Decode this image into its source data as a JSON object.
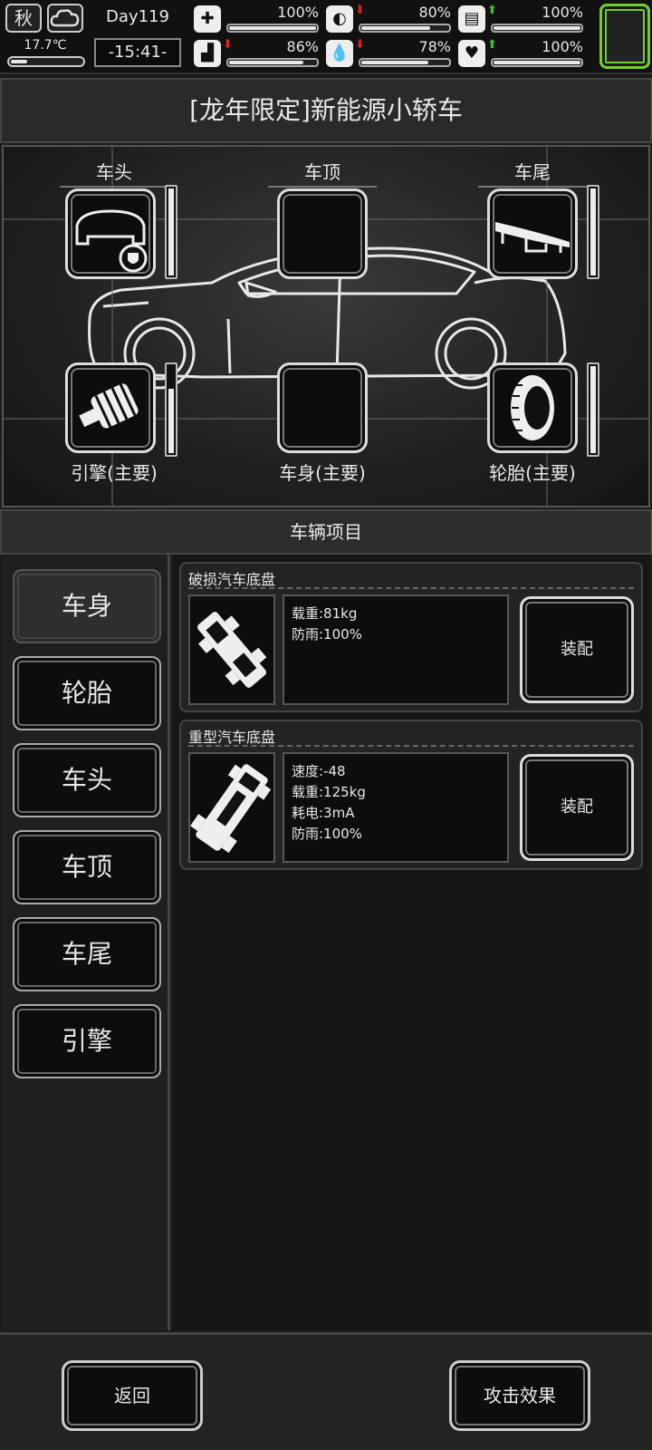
{
  "status": {
    "season": "秋",
    "temperature": "17.7℃",
    "day": "Day119",
    "time": "-15:41-",
    "stats": [
      {
        "name": "health",
        "icon": "medkit-icon",
        "value": "100%",
        "level": 1.0,
        "trend": ""
      },
      {
        "name": "hunger",
        "icon": "stomach-icon",
        "value": "80%",
        "level": 0.8,
        "trend": "down"
      },
      {
        "name": "energy",
        "icon": "battery-icon",
        "value": "100%",
        "level": 1.0,
        "trend": "up"
      },
      {
        "name": "stamina",
        "icon": "boot-icon",
        "value": "86%",
        "level": 0.86,
        "trend": "down"
      },
      {
        "name": "thirst",
        "icon": "water-drop-icon",
        "value": "78%",
        "level": 0.78,
        "trend": "down"
      },
      {
        "name": "mood",
        "icon": "heart-icon",
        "value": "100%",
        "level": 1.0,
        "trend": "up"
      }
    ],
    "colors": {
      "up": "#39c21f",
      "down": "#e02020",
      "slot": "#6fcf2e"
    }
  },
  "title": "[龙年限定]新能源小轿车",
  "car_parts": {
    "front": {
      "label": "车头",
      "durability": 1.0
    },
    "roof": {
      "label": "车顶"
    },
    "rear": {
      "label": "车尾",
      "durability": 1.0
    },
    "engine": {
      "label": "引擎(主要)",
      "durability": 0.75
    },
    "body": {
      "label": "车身(主要)"
    },
    "tire": {
      "label": "轮胎(主要)",
      "durability": 1.0
    }
  },
  "section_title": "车辆项目",
  "categories": [
    "车身",
    "轮胎",
    "车头",
    "车顶",
    "车尾",
    "引擎"
  ],
  "items": [
    {
      "name": "破损汽车底盘",
      "stats": [
        "载重:81kg",
        "防雨:100%"
      ],
      "action": "装配"
    },
    {
      "name": "重型汽车底盘",
      "stats": [
        "速度:-48",
        "载重:125kg",
        "耗电:3mA",
        "防雨:100%"
      ],
      "action": "装配"
    }
  ],
  "footer": {
    "back": "返回",
    "attack_effect": "攻击效果"
  }
}
